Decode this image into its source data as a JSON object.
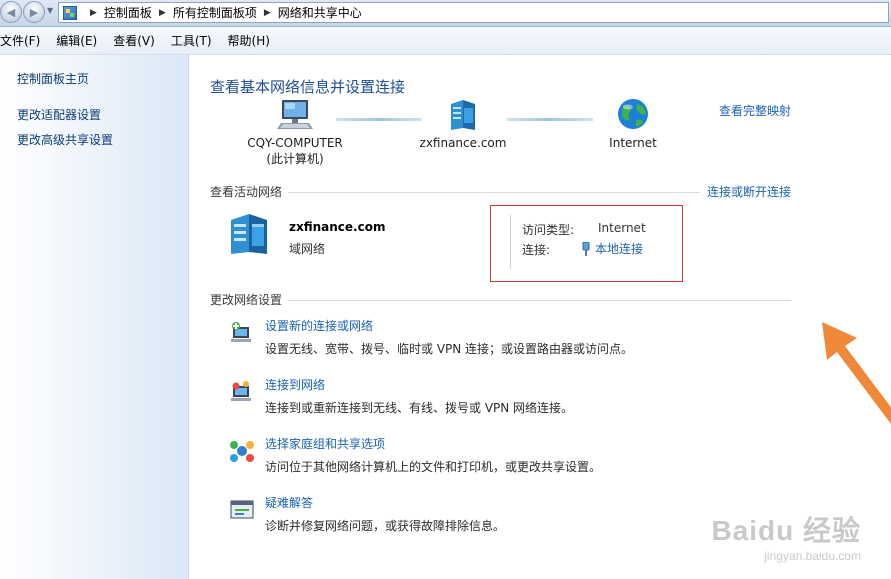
{
  "addressbar": {
    "breadcrumbs": [
      "控制面板",
      "所有控制面板项",
      "网络和共享中心"
    ]
  },
  "menubar": {
    "items": [
      "文件(F)",
      "编辑(E)",
      "查看(V)",
      "工具(T)",
      "帮助(H)"
    ]
  },
  "sidebar": {
    "items": [
      {
        "label": "控制面板主页"
      },
      {
        "label": "更改适配器设置"
      },
      {
        "label": "更改高级共享设置"
      }
    ]
  },
  "main": {
    "title": "查看基本网络信息并设置连接",
    "full_map_link": "查看完整映射",
    "map": {
      "computer_name": "CQY-COMPUTER",
      "computer_sub": "(此计算机)",
      "domain": "zxfinance.com",
      "internet": "Internet"
    },
    "active": {
      "section_title": "查看活动网络",
      "connect_link": "连接或断开连接",
      "network_name": "zxfinance.com",
      "network_type": "域网络",
      "access_label": "访问类型:",
      "access_value": "Internet",
      "connection_label": "连接:",
      "connection_value": "本地连接"
    },
    "change": {
      "section_title": "更改网络设置",
      "tasks": [
        {
          "link": "设置新的连接或网络",
          "desc": "设置无线、宽带、拨号、临时或 VPN 连接；或设置路由器或访问点。",
          "icon": "new-connection-icon"
        },
        {
          "link": "连接到网络",
          "desc": "连接到或重新连接到无线、有线、拨号或 VPN 网络连接。",
          "icon": "connect-network-icon"
        },
        {
          "link": "选择家庭组和共享选项",
          "desc": "访问位于其他网络计算机上的文件和打印机，或更改共享设置。",
          "icon": "homegroup-icon"
        },
        {
          "link": "疑难解答",
          "desc": "诊断并修复网络问题，或获得故障排除信息。",
          "icon": "troubleshoot-icon"
        }
      ]
    }
  },
  "watermark": {
    "brand": "Baidu 经验",
    "url": "jingyan.baidu.com"
  },
  "colors": {
    "link": "#1a62b8",
    "title": "#1e4e96",
    "highlight_box": "#d9362e",
    "arrow": "#f0883a"
  }
}
